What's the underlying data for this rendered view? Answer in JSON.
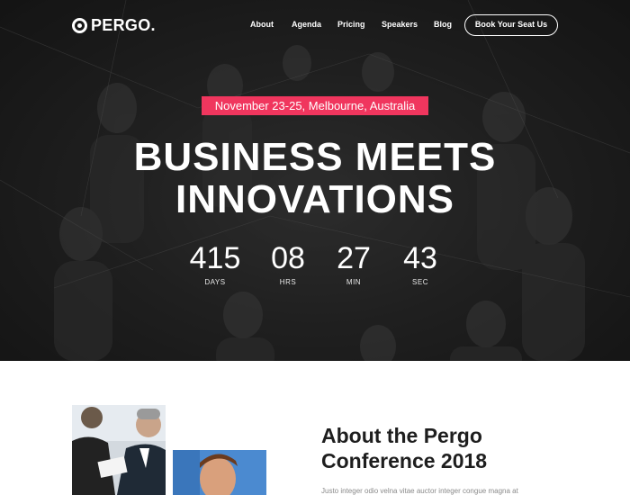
{
  "navbar": {
    "logo_text": "PERGO.",
    "links": [
      "About",
      "Agenda",
      "Pricing",
      "Speakers",
      "Blog"
    ],
    "cta_label": "Book Your Seat Us"
  },
  "hero": {
    "date_location": "November 23-25, Melbourne, Australia",
    "headline_line1": "BUSINESS MEETS",
    "headline_line2": "INNOVATIONS",
    "countdown": [
      {
        "value": "415",
        "unit": "DAYS"
      },
      {
        "value": "08",
        "unit": "HRS"
      },
      {
        "value": "27",
        "unit": "MIN"
      },
      {
        "value": "43",
        "unit": "SEC"
      }
    ]
  },
  "about": {
    "title_line1": "About the Pergo",
    "title_line2": "Conference 2018",
    "text": "Justo integer odio velna vitae auctor integer congue magna at"
  },
  "colors": {
    "accent": "#f0365e",
    "hero_bg": "#262626",
    "heading_dark": "#1e1e1e"
  }
}
